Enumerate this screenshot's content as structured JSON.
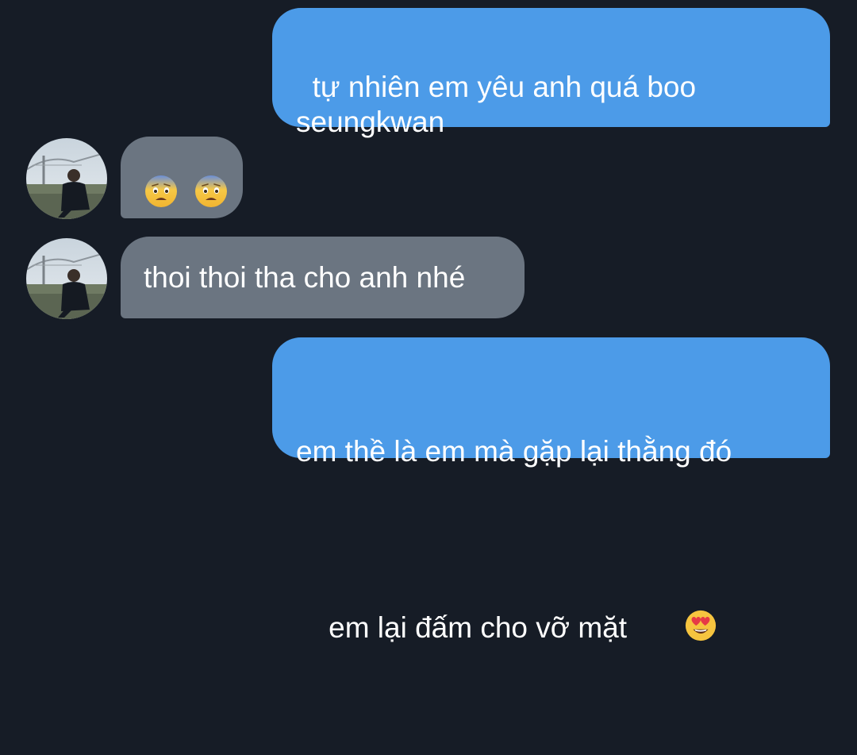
{
  "messages": [
    {
      "direction": "outgoing",
      "text": "tự nhiên em yêu anh quá boo\nseungkwan"
    },
    {
      "direction": "incoming",
      "emoji": [
        "anxious-face-emoji",
        "anxious-face-emoji"
      ]
    },
    {
      "direction": "incoming",
      "text": "thoi thoi tha cho anh nhé"
    },
    {
      "direction": "outgoing",
      "text_line1": "em thề là em mà gặp lại thằng đó",
      "text_line2": "em lại đấm cho vỡ mặt ",
      "emoji": [
        "heart-eyes-emoji"
      ]
    }
  ],
  "colors": {
    "background": "#161c26",
    "outgoing_bubble": "#4c9be8",
    "incoming_bubble": "#6b7581",
    "text": "#ffffff"
  }
}
